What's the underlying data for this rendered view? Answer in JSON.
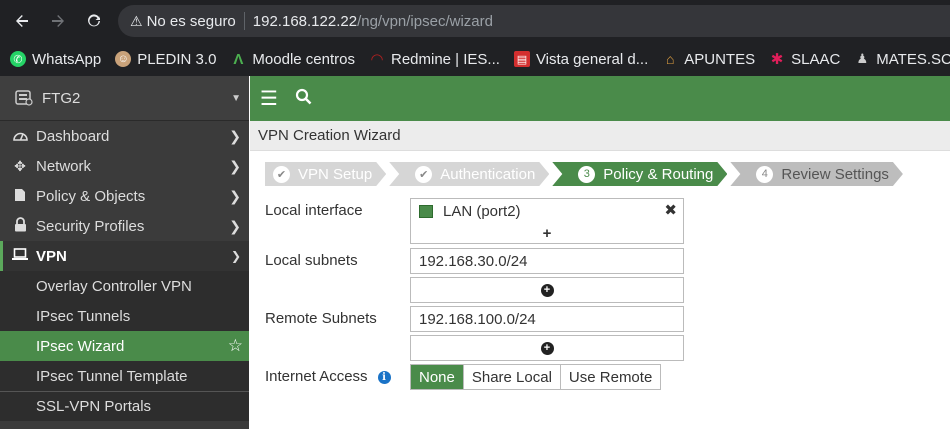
{
  "browser": {
    "not_secure": "No es seguro",
    "url_host": "192.168.122.22",
    "url_path": "/ng/vpn/ipsec/wizard"
  },
  "bookmarks": [
    {
      "label": "WhatsApp",
      "icon": "whatsapp-icon",
      "color": "#25d366"
    },
    {
      "label": "PLEDIN 3.0",
      "icon": "pledin-icon",
      "color": "#c9a27a"
    },
    {
      "label": "Moodle centros",
      "icon": "moodle-icon",
      "color": "#2e7d32"
    },
    {
      "label": "Redmine | IES...",
      "icon": "redmine-icon",
      "color": "#b32020"
    },
    {
      "label": "Vista general d...",
      "icon": "vista-icon",
      "color": "#d32f2f"
    },
    {
      "label": "APUNTES",
      "icon": "apuntes-icon",
      "color": "#e0a040"
    },
    {
      "label": "SLAAC",
      "icon": "slack-icon",
      "color": "#e01e5a"
    },
    {
      "label": "MATES.SCI",
      "icon": "mates-icon",
      "color": "#444"
    }
  ],
  "sidebar": {
    "device": "FTG2",
    "items": [
      {
        "label": "Dashboard"
      },
      {
        "label": "Network"
      },
      {
        "label": "Policy & Objects"
      },
      {
        "label": "Security Profiles"
      },
      {
        "label": "VPN"
      }
    ],
    "vpn_sub": [
      {
        "label": "Overlay Controller VPN"
      },
      {
        "label": "IPsec Tunnels"
      },
      {
        "label": "IPsec Wizard"
      },
      {
        "label": "IPsec Tunnel Template"
      },
      {
        "label": "SSL-VPN Portals"
      }
    ]
  },
  "page_title": "VPN Creation Wizard",
  "steps": [
    {
      "num": "✔",
      "label": "VPN Setup"
    },
    {
      "num": "✔",
      "label": "Authentication"
    },
    {
      "num": "3",
      "label": "Policy & Routing"
    },
    {
      "num": "4",
      "label": "Review Settings"
    }
  ],
  "form": {
    "local_interface_label": "Local interface",
    "local_interface_value": "LAN (port2)",
    "local_subnets_label": "Local subnets",
    "local_subnets_value": "192.168.30.0/24",
    "remote_subnets_label": "Remote Subnets",
    "remote_subnets_value": "192.168.100.0/24",
    "internet_access_label": "Internet Access",
    "internet_options": [
      "None",
      "Share Local",
      "Use Remote"
    ],
    "internet_selected": "None"
  },
  "colors": {
    "accent": "#4a8b4a",
    "sidebar_bg": "#3b3b3b"
  }
}
